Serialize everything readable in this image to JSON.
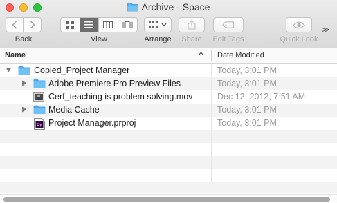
{
  "window": {
    "title": "Archive - Space",
    "title_icon": "folder-icon"
  },
  "toolbar": {
    "back_label": "Back",
    "view_label": "View",
    "arrange_label": "Arrange",
    "share_label": "Share",
    "edit_tags_label": "Edit Tags",
    "quick_look_label": "Quick Look",
    "overflow_glyph": ">>"
  },
  "columns": {
    "name": "Name",
    "date_modified": "Date Modified"
  },
  "files": [
    {
      "name": "Copied_Project Manager",
      "date": "Today, 3:01 PM",
      "kind": "folder",
      "disclosure": "expanded",
      "depth": 0
    },
    {
      "name": "Adobe Premiere Pro Preview Files",
      "date": "Today, 3:01 PM",
      "kind": "folder",
      "disclosure": "collapsed",
      "depth": 1
    },
    {
      "name": "Cerf_teaching is problem solving.mov",
      "date": "Dec 12, 2012, 7:51 AM",
      "kind": "movie",
      "disclosure": "none",
      "depth": 1
    },
    {
      "name": "Media Cache",
      "date": "Today, 3:01 PM",
      "kind": "folder",
      "disclosure": "collapsed",
      "depth": 1
    },
    {
      "name": "Project Manager.prproj",
      "date": "Today, 3:01 PM",
      "kind": "premiere-project",
      "disclosure": "none",
      "depth": 1,
      "badge": "Pr"
    }
  ],
  "colors": {
    "folder": "#5ab4f0",
    "premiere": "#2a0a3a",
    "premiere_text": "#e99df5"
  }
}
